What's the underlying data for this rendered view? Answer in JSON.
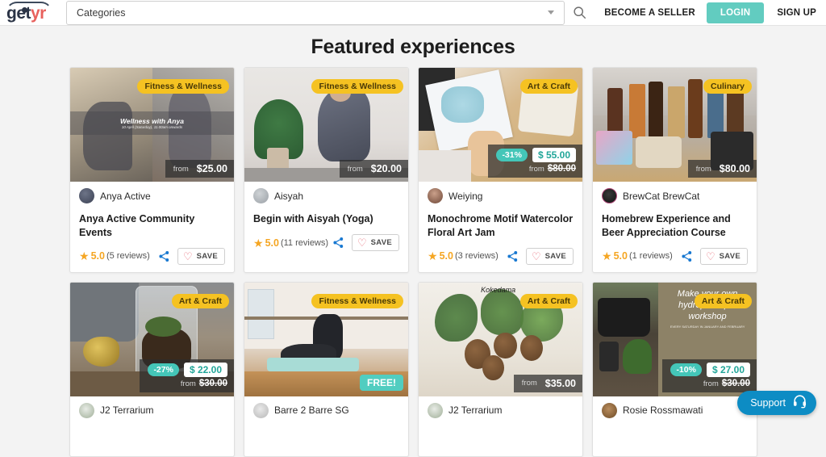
{
  "header": {
    "logo_get": "get",
    "logo_yr": "yr",
    "categories_label": "Categories",
    "search_icon": "search-icon",
    "chevron_icon": "chevron-down-icon",
    "become_seller": "BECOME A SELLER",
    "login": "LOGIN",
    "signup": "SIGN UP",
    "login_bg": "#62ccc0"
  },
  "page": {
    "title": "Featured experiences"
  },
  "support": {
    "label": "Support",
    "icon": "headset-icon",
    "color": "#0d8cc4"
  },
  "labels": {
    "from": "from",
    "save": "SAVE",
    "share_icon": "share-icon",
    "heart_icon": "heart-icon",
    "star_icon": "star-icon"
  },
  "cards": [
    {
      "category": "Fitness & Wellness",
      "vendor": "Anya Active",
      "title": "Anya Active Community Events",
      "rating": "5.0",
      "reviews": "(5 reviews)",
      "price": "$25.00",
      "discount": null,
      "old_price": null,
      "free": false,
      "overlay_title": "Wellness with Anya",
      "overlay_sub": "10 April (Saturday), 11.00am onwards"
    },
    {
      "category": "Fitness & Wellness",
      "vendor": "Aisyah",
      "title": "Begin with Aisyah (Yoga)",
      "rating": "5.0",
      "reviews": "(11 reviews)",
      "price": "$20.00",
      "discount": null,
      "old_price": null,
      "free": false
    },
    {
      "category": "Art & Craft",
      "vendor": "Weiying",
      "title": "Monochrome Motif Watercolor Floral Art Jam",
      "rating": "5.0",
      "reviews": "(3 reviews)",
      "price": "$ 55.00",
      "discount": "-31%",
      "old_price": "$80.00",
      "free": false
    },
    {
      "category": "Culinary",
      "vendor": "BrewCat BrewCat",
      "title": "Homebrew Experience and Beer Appreciation Course",
      "rating": "5.0",
      "reviews": "(1 reviews)",
      "price": "$80.00",
      "discount": null,
      "old_price": null,
      "free": false
    },
    {
      "category": "Art & Craft",
      "vendor": "J2 Terrarium",
      "title": "",
      "rating": "",
      "reviews": "",
      "price": "$ 22.00",
      "discount": "-27%",
      "old_price": "$30.00",
      "free": false
    },
    {
      "category": "Fitness & Wellness",
      "vendor": "Barre 2 Barre SG",
      "title": "",
      "rating": "",
      "reviews": "",
      "price": "",
      "discount": null,
      "old_price": null,
      "free": true,
      "free_label": "FREE!"
    },
    {
      "category": "Art & Craft",
      "vendor": "J2 Terrarium",
      "title": "",
      "rating": "",
      "reviews": "",
      "price": "$35.00",
      "discount": null,
      "old_price": null,
      "free": false,
      "overlay_title": "Kokedama"
    },
    {
      "category": "Art & Craft",
      "vendor": "Rosie Rossmawati",
      "title": "",
      "rating": "",
      "reviews": "",
      "price": "$ 27.00",
      "discount": "-10%",
      "old_price": "$30.00",
      "free": false,
      "overlay_title": "Make your own hydroponic pot workshop",
      "overlay_sub": "EVERY SATURDAY IN JANUARY AND FEBRUARY"
    }
  ]
}
